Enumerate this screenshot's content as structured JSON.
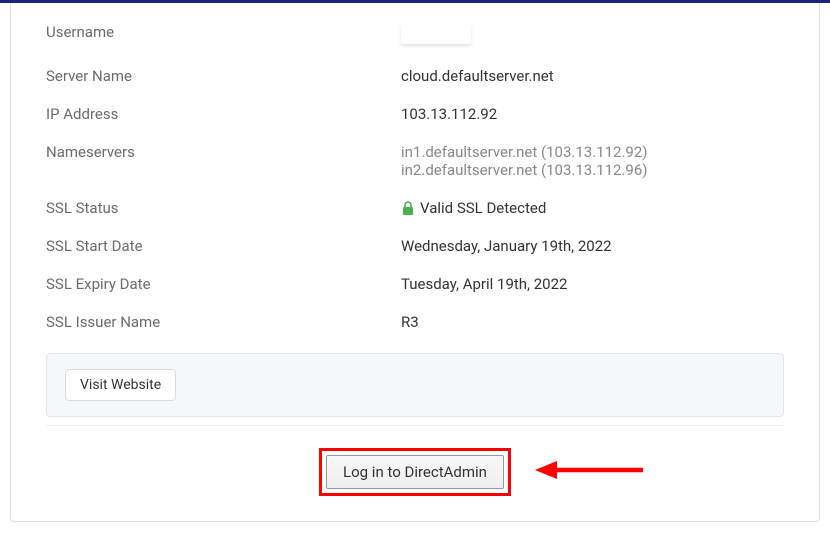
{
  "fields": {
    "username": {
      "label": "Username",
      "value": ""
    },
    "serverName": {
      "label": "Server Name",
      "value": "cloud.defaultserver.net"
    },
    "ipAddress": {
      "label": "IP Address",
      "value": "103.13.112.92"
    },
    "nameservers": {
      "label": "Nameservers",
      "ns1": "in1.defaultserver.net (103.13.112.92)",
      "ns2": "in2.defaultserver.net (103.13.112.96)"
    },
    "sslStatus": {
      "label": "SSL Status",
      "value": "Valid SSL Detected"
    },
    "sslStart": {
      "label": "SSL Start Date",
      "value": "Wednesday, January 19th, 2022"
    },
    "sslExpiry": {
      "label": "SSL Expiry Date",
      "value": "Tuesday, April 19th, 2022"
    },
    "sslIssuer": {
      "label": "SSL Issuer Name",
      "value": "R3"
    }
  },
  "buttons": {
    "visitWebsite": "Visit Website",
    "loginDirectAdmin": "Log in to DirectAdmin"
  }
}
